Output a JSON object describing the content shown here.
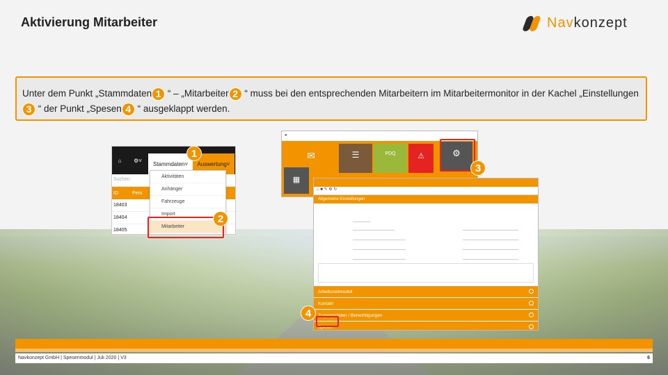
{
  "title": "Aktivierung Mitarbeiter",
  "logo": {
    "part1": "Nav",
    "part2": "konzept"
  },
  "instruction": {
    "t1": "Unter dem Punkt „Stammdaten",
    "t2": " “ – „Mitarbeiter",
    "t3": " “ muss bei den entsprechenden Mitarbeitern im Mitarbeitermonitor in der Kachel „Einstellungen",
    "t4": " “ der Punkt „Spesen",
    "t5": " “ ausgeklappt werden."
  },
  "badges": [
    "1",
    "2",
    "3",
    "4"
  ],
  "shot1": {
    "nav_stammdaten": "Stammdaten",
    "nav_auswertung": "Auswertung",
    "search_placeholder": "Suchen",
    "col_id": "ID",
    "col_person": "Pers",
    "rows": [
      "18403",
      "18404",
      "18405"
    ],
    "menu": [
      "Aktivitäten",
      "Anhänger",
      "Fahrzeuge",
      "Import",
      "Mitarbeiter"
    ]
  },
  "shot2": {
    "tile_labels": [
      "",
      "",
      "PDQ",
      "",
      "",
      "Einstellungen"
    ]
  },
  "shot3": {
    "section_title": "Allgemeine Einstellungen",
    "accordion": [
      "Arbeitszeitmodell",
      "Kontakt",
      "Zugangsdaten / Berechtigungen",
      "Spesen"
    ]
  },
  "footer": {
    "text": "Navkonzept GmbH  |  Spesenmodul  |  Juli 2020 | V3",
    "page": "6"
  },
  "colors": {
    "accent": "#f29400",
    "highlight": "#e52421"
  }
}
